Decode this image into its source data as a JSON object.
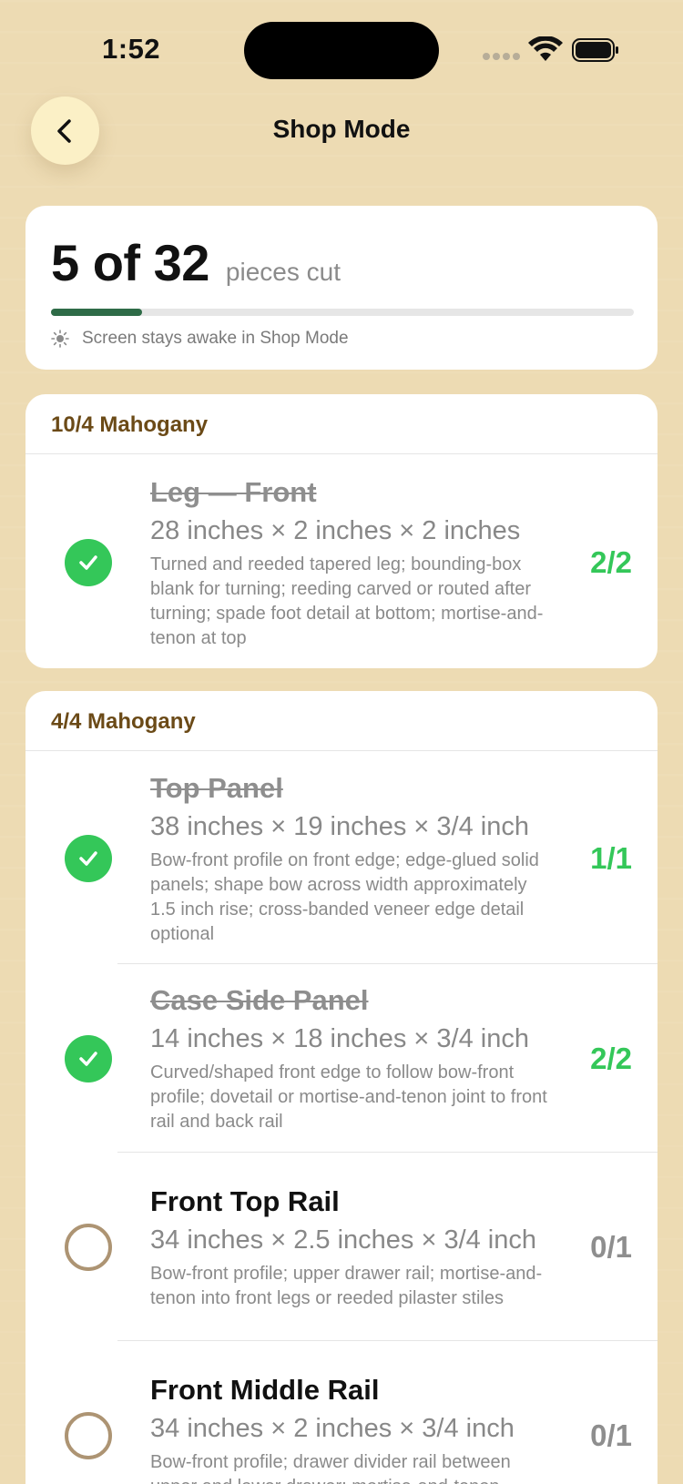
{
  "status": {
    "time": "1:52"
  },
  "header": {
    "title": "Shop Mode"
  },
  "progress": {
    "cut": "5 of 32",
    "label": "pieces cut",
    "fraction": 0.156,
    "awake_note": "Screen stays awake in Shop Mode"
  },
  "colors": {
    "done": "#34c759",
    "progress": "#2e6b47",
    "group_header": "#6b4a17",
    "background": "#eddbb3"
  },
  "groups": [
    {
      "name": "10/4 Mahogany",
      "pieces": [
        {
          "name": "Leg — Front",
          "dims": "28 inches × 2 inches × 2 inches",
          "notes": "Turned and reeded tapered leg; bounding-box blank for turning; reeding carved or routed after turning; spade foot detail at bottom; mortise-and-tenon at top",
          "count": "2/2",
          "done": true
        }
      ]
    },
    {
      "name": "4/4 Mahogany",
      "pieces": [
        {
          "name": "Top Panel",
          "dims": "38 inches × 19 inches × 3/4 inch",
          "notes": "Bow-front profile on front edge; edge-glued solid panels; shape bow across width approximately 1.5 inch rise; cross-banded veneer edge detail optional",
          "count": "1/1",
          "done": true
        },
        {
          "name": "Case Side Panel",
          "dims": "14 inches × 18 inches × 3/4 inch",
          "notes": "Curved/shaped front edge to follow bow-front profile; dovetail or mortise-and-tenon joint to front rail and back rail",
          "count": "2/2",
          "done": true
        },
        {
          "name": "Front Top Rail",
          "dims": "34 inches × 2.5 inches × 3/4 inch",
          "notes": "Bow-front profile; upper drawer rail; mortise-and-tenon into front legs or reeded pilaster stiles",
          "count": "0/1",
          "done": false
        },
        {
          "name": "Front Middle Rail",
          "dims": "34 inches × 2 inches × 3/4 inch",
          "notes": "Bow-front profile; drawer divider rail between upper and lower drawer; mortise-and-tenon",
          "count": "0/1",
          "done": false
        }
      ]
    }
  ]
}
